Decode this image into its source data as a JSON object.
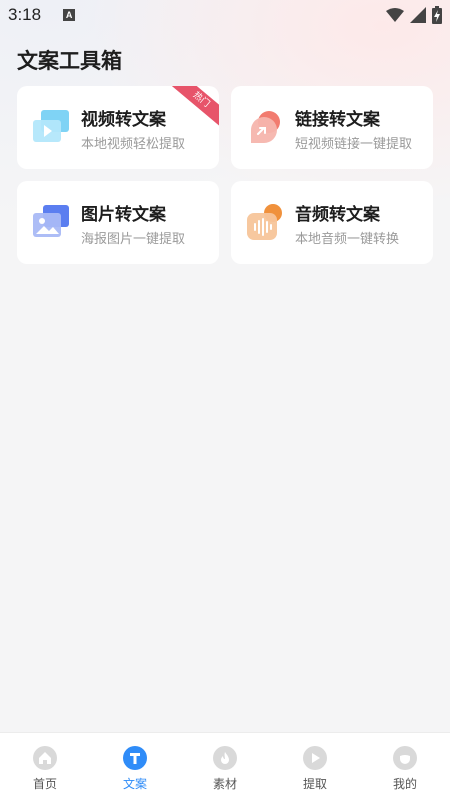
{
  "status_bar": {
    "time": "3:18",
    "notification_letter": "A"
  },
  "page": {
    "title": "文案工具箱"
  },
  "tools": [
    {
      "title": "视频转文案",
      "subtitle": "本地视频轻松提取",
      "badge": "热门",
      "icon": "video-icon"
    },
    {
      "title": "链接转文案",
      "subtitle": "短视频链接一键提取",
      "icon": "link-icon"
    },
    {
      "title": "图片转文案",
      "subtitle": "海报图片一键提取",
      "icon": "image-icon"
    },
    {
      "title": "音频转文案",
      "subtitle": "本地音频一键转换",
      "icon": "audio-icon"
    }
  ],
  "tabbar": {
    "active": 1,
    "items": [
      {
        "label": "首页",
        "icon": "home-icon"
      },
      {
        "label": "文案",
        "icon": "text-icon"
      },
      {
        "label": "素材",
        "icon": "flame-icon"
      },
      {
        "label": "提取",
        "icon": "play-icon"
      },
      {
        "label": "我的",
        "icon": "profile-icon"
      }
    ]
  },
  "colors": {
    "accent": "#2f8cf8",
    "badge": "#e7546a",
    "background": "#f5f5f6"
  }
}
